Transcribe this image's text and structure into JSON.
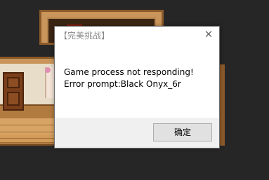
{
  "dialog": {
    "title": "【完美挑战】",
    "close_glyph": "✕",
    "message_line1": "Game process not responding!",
    "message_line2": "Error prompt:Black Onyx_6r",
    "ok_label": "确定"
  },
  "colors": {
    "background": "#262626",
    "dialog_bg": "#ffffff",
    "footer_bg": "#f0f0f0",
    "button_bg": "#e1e1e1"
  }
}
